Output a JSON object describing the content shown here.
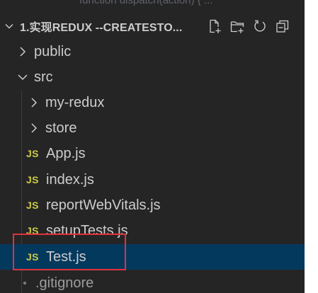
{
  "top_strip_text": "function dispatch(action) { ...",
  "explorer": {
    "project_title": "1.实现REDUX --CREATESTO...",
    "header_actions": [
      {
        "name": "new-file-icon"
      },
      {
        "name": "new-folder-icon"
      },
      {
        "name": "refresh-icon"
      },
      {
        "name": "collapse-all-icon"
      }
    ],
    "tree": [
      {
        "label": "public",
        "type": "folder",
        "expanded": false,
        "depth": 0
      },
      {
        "label": "src",
        "type": "folder",
        "expanded": true,
        "depth": 0
      },
      {
        "label": "my-redux",
        "type": "folder",
        "expanded": false,
        "depth": 1
      },
      {
        "label": "store",
        "type": "folder",
        "expanded": false,
        "depth": 1
      },
      {
        "label": "App.js",
        "type": "js",
        "badge": "JS",
        "depth": 1
      },
      {
        "label": "index.js",
        "type": "js",
        "badge": "JS",
        "depth": 1
      },
      {
        "label": "reportWebVitals.js",
        "type": "js",
        "badge": "JS",
        "depth": 1
      },
      {
        "label": "setupTests.js",
        "type": "js",
        "badge": "JS",
        "depth": 1
      },
      {
        "label": "Test.js",
        "type": "js",
        "badge": "JS",
        "depth": 1,
        "selected": true
      },
      {
        "label": ".gitignore",
        "type": "dotfile",
        "depth": 0
      }
    ]
  },
  "colors": {
    "panel_bg": "#252526",
    "selected_bg": "#04395e",
    "js_badge": "#cbcb41",
    "highlight_border": "#e0323a"
  }
}
